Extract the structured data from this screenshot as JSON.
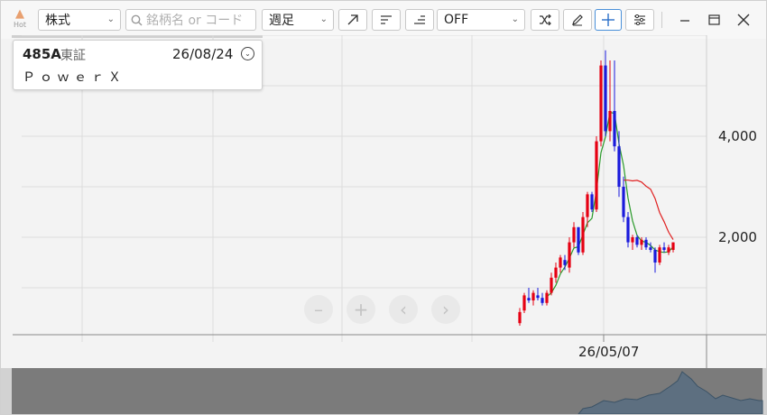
{
  "toolbar": {
    "hot_label": "Hot",
    "asset_type": "株式",
    "search_placeholder": "銘柄名 or コード",
    "period": "週足",
    "indicator": "OFF"
  },
  "info": {
    "code": "485A",
    "market": "東証",
    "date": "26/08/24",
    "name": "ＰｏｗｅｒＸ"
  },
  "chart_data": {
    "type": "candlestick",
    "x_label_visible": "26/05/07",
    "y_ticks": [
      "4,000",
      "2,000"
    ],
    "moving_averages": [
      {
        "color": "#2a9a2a"
      },
      {
        "color": "#e02020"
      }
    ],
    "up_color": "#e60012",
    "down_color": "#1a1adc",
    "candles": [
      {
        "o": 300,
        "h": 600,
        "l": 250,
        "c": 520
      },
      {
        "o": 550,
        "h": 900,
        "l": 500,
        "c": 850
      },
      {
        "o": 800,
        "h": 1000,
        "l": 700,
        "c": 750
      },
      {
        "o": 750,
        "h": 950,
        "l": 650,
        "c": 900
      },
      {
        "o": 850,
        "h": 1000,
        "l": 750,
        "c": 800
      },
      {
        "o": 800,
        "h": 900,
        "l": 650,
        "c": 700
      },
      {
        "o": 700,
        "h": 950,
        "l": 650,
        "c": 900
      },
      {
        "o": 900,
        "h": 1300,
        "l": 850,
        "c": 1200
      },
      {
        "o": 1200,
        "h": 1500,
        "l": 1100,
        "c": 1400
      },
      {
        "o": 1400,
        "h": 1650,
        "l": 1300,
        "c": 1600
      },
      {
        "o": 1550,
        "h": 1650,
        "l": 1350,
        "c": 1450
      },
      {
        "o": 1400,
        "h": 2000,
        "l": 1300,
        "c": 1900
      },
      {
        "o": 1900,
        "h": 2300,
        "l": 1800,
        "c": 2200
      },
      {
        "o": 2200,
        "h": 2200,
        "l": 1650,
        "c": 1700
      },
      {
        "o": 1700,
        "h": 2500,
        "l": 1650,
        "c": 2400
      },
      {
        "o": 2400,
        "h": 2900,
        "l": 2200,
        "c": 2850
      },
      {
        "o": 2850,
        "h": 2900,
        "l": 2500,
        "c": 2550
      },
      {
        "o": 2550,
        "h": 4000,
        "l": 2500,
        "c": 3900
      },
      {
        "o": 3900,
        "h": 5500,
        "l": 3800,
        "c": 5400
      },
      {
        "o": 5400,
        "h": 5700,
        "l": 4000,
        "c": 4100
      },
      {
        "o": 4100,
        "h": 5500,
        "l": 3900,
        "c": 4500
      },
      {
        "o": 4500,
        "h": 5500,
        "l": 3700,
        "c": 3800
      },
      {
        "o": 3800,
        "h": 4100,
        "l": 2800,
        "c": 3000
      },
      {
        "o": 3000,
        "h": 3200,
        "l": 2300,
        "c": 2400
      },
      {
        "o": 2400,
        "h": 2500,
        "l": 1800,
        "c": 1900
      },
      {
        "o": 1900,
        "h": 2050,
        "l": 1750,
        "c": 2000
      },
      {
        "o": 2000,
        "h": 2050,
        "l": 1800,
        "c": 1850
      },
      {
        "o": 1850,
        "h": 2000,
        "l": 1750,
        "c": 1950
      },
      {
        "o": 1950,
        "h": 2000,
        "l": 1750,
        "c": 1800
      },
      {
        "o": 1800,
        "h": 1900,
        "l": 1700,
        "c": 1750
      },
      {
        "o": 1750,
        "h": 1800,
        "l": 1300,
        "c": 1500
      },
      {
        "o": 1500,
        "h": 1850,
        "l": 1450,
        "c": 1800
      },
      {
        "o": 1800,
        "h": 1900,
        "l": 1700,
        "c": 1750
      },
      {
        "o": 1700,
        "h": 1850,
        "l": 1650,
        "c": 1800
      },
      {
        "o": 1750,
        "h": 1900,
        "l": 1700,
        "c": 1900
      }
    ]
  }
}
